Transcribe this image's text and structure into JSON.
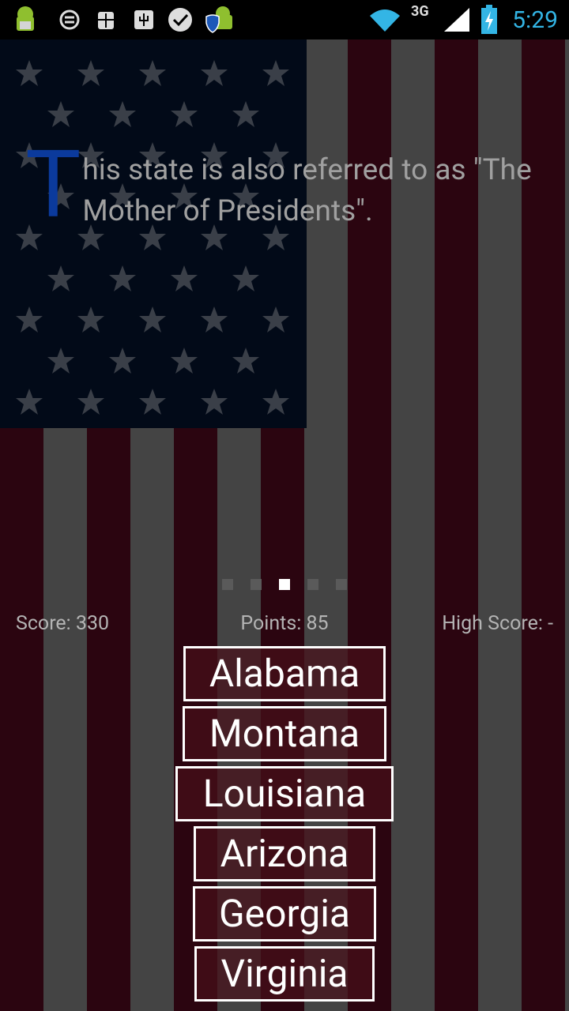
{
  "status_bar": {
    "time": "5:29",
    "network": "3G",
    "icons": [
      "android-debug-icon",
      "sync-icon",
      "bug-icon",
      "usb-icon",
      "check-bubble-icon",
      "android-shield-icon",
      "wifi-icon",
      "signal-icon",
      "battery-charging-icon"
    ]
  },
  "question": {
    "drop_cap": "T",
    "text": "his state is also referred to as \"The Mother of Presidents\"."
  },
  "pager": {
    "total": 5,
    "active_index": 2
  },
  "scores": {
    "score": "Score: 330",
    "points": "Points: 85",
    "high_score": "High Score: -"
  },
  "answers": [
    "Alabama",
    "Montana",
    "Louisiana",
    "Arizona",
    "Georgia",
    "Virginia"
  ],
  "colors": {
    "accent_time": "#33b5e5",
    "drop_cap": "#0b3a9c",
    "stripe_red": "#2b0510",
    "stripe_gray": "#444444",
    "canton": "#020a18"
  }
}
